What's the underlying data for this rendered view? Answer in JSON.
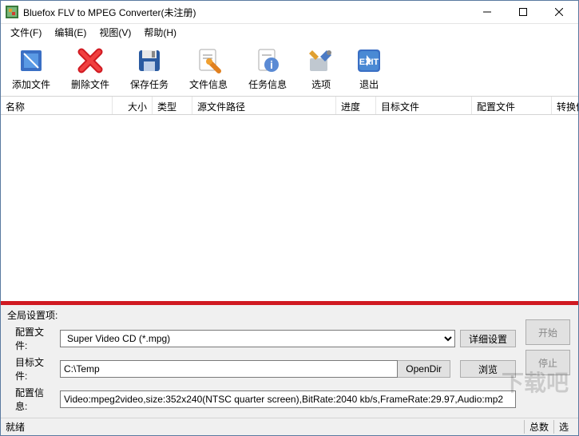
{
  "window": {
    "title": "Bluefox FLV to MPEG Converter(未注册)"
  },
  "menu": {
    "file": "文件(F)",
    "edit": "编辑(E)",
    "view": "视图(V)",
    "help": "帮助(H)"
  },
  "toolbar": {
    "add": "添加文件",
    "delete": "删除文件",
    "save": "保存任务",
    "fileinfo": "文件信息",
    "taskinfo": "任务信息",
    "options": "选项",
    "exit": "退出"
  },
  "columns": {
    "name": "名称",
    "size": "大小",
    "type": "类型",
    "srcpath": "源文件路径",
    "progress": "进度",
    "target": "目标文件",
    "profile": "配置文件",
    "convinfo": "转换信"
  },
  "panel": {
    "title": "全局设置项:",
    "profile_label": "配置文件:",
    "profile_value": "Super Video CD (*.mpg)",
    "detail_btn": "详细设置",
    "target_label": "目标文件:",
    "target_value": "C:\\Temp",
    "opendir_btn": "OpenDir",
    "browse_btn": "浏览",
    "info_label": "配置信息:",
    "info_value": "Video:mpeg2video,size:352x240(NTSC quarter screen),BitRate:2040 kb/s,FrameRate:29.97,Audio:mp2",
    "start_btn": "开始",
    "stop_btn": "停止"
  },
  "status": {
    "ready": "就绪",
    "total": "总数",
    "selected": "选"
  }
}
